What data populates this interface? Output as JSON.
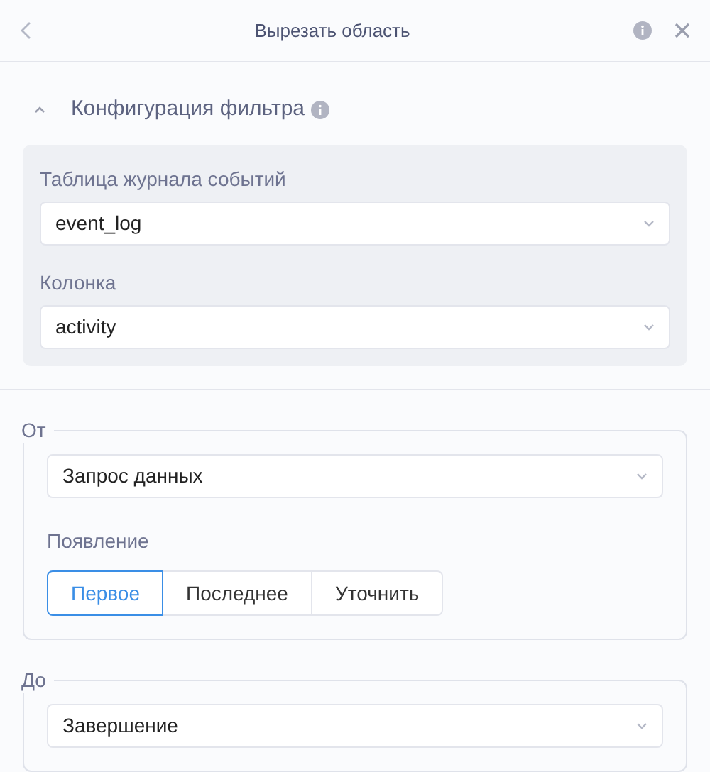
{
  "header": {
    "title": "Вырезать область"
  },
  "filter_section": {
    "title": "Конфигурация фильтра",
    "expanded": true,
    "fields": [
      {
        "label": "Таблица журнала событий",
        "value": "event_log"
      },
      {
        "label": "Колонка",
        "value": "activity"
      }
    ]
  },
  "from": {
    "legend": "От",
    "value": "Запрос данных",
    "occurrence_label": "Появление",
    "options": [
      {
        "label": "Первое",
        "selected": true
      },
      {
        "label": "Последнее",
        "selected": false
      },
      {
        "label": "Уточнить",
        "selected": false
      }
    ]
  },
  "to": {
    "legend": "До",
    "value": "Завершение"
  }
}
